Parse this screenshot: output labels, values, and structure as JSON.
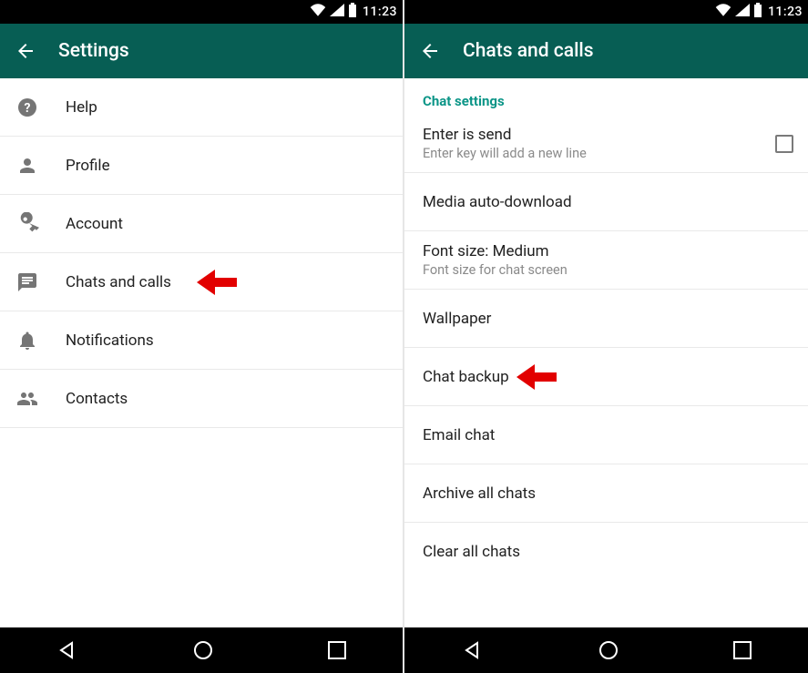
{
  "status": {
    "time": "11:23"
  },
  "left": {
    "title": "Settings",
    "items": [
      {
        "label": "Help"
      },
      {
        "label": "Profile"
      },
      {
        "label": "Account"
      },
      {
        "label": "Chats and calls"
      },
      {
        "label": "Notifications"
      },
      {
        "label": "Contacts"
      }
    ]
  },
  "right": {
    "title": "Chats and calls",
    "section": "Chat settings",
    "items": [
      {
        "label": "Enter is send",
        "sub": "Enter key will add a new line"
      },
      {
        "label": "Media auto-download"
      },
      {
        "label": "Font size: Medium",
        "sub": "Font size for chat screen"
      },
      {
        "label": "Wallpaper"
      },
      {
        "label": "Chat backup"
      },
      {
        "label": "Email chat"
      },
      {
        "label": "Archive all chats"
      },
      {
        "label": "Clear all chats"
      }
    ]
  }
}
